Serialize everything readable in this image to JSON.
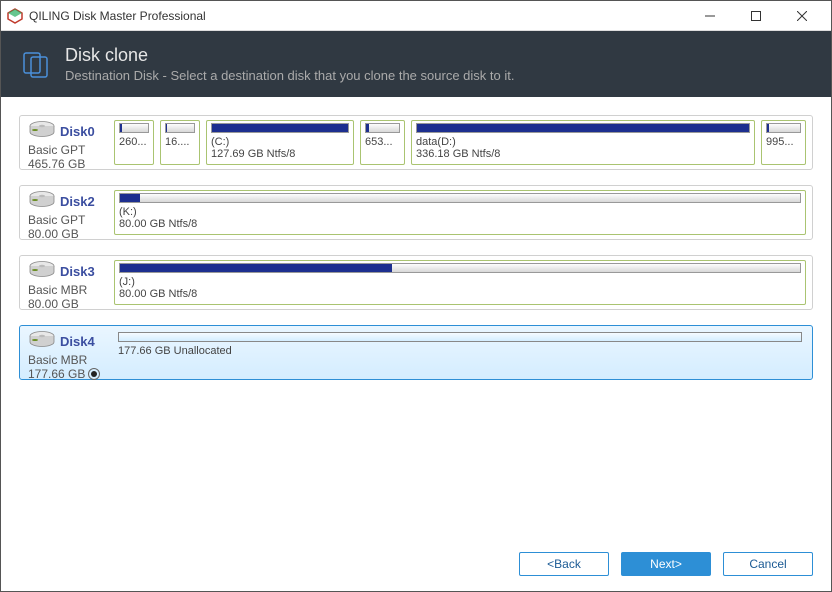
{
  "window": {
    "title": "QILING Disk Master Professional"
  },
  "header": {
    "title": "Disk clone",
    "subtitle": "Destination Disk - Select a destination disk that you clone the source disk to it."
  },
  "disks": [
    {
      "name": "Disk0",
      "type": "Basic GPT",
      "size": "465.76 GB",
      "selected": false,
      "partitions": [
        {
          "label": "",
          "sub": "260...",
          "fill": 6,
          "flex": "0 0 40px"
        },
        {
          "label": "",
          "sub": "16....",
          "fill": 3,
          "flex": "0 0 40px"
        },
        {
          "label": "(C:)",
          "sub": "127.69 GB Ntfs/8",
          "fill": 100,
          "flex": "0 0 148px"
        },
        {
          "label": "",
          "sub": "653...",
          "fill": 8,
          "flex": "0 0 45px"
        },
        {
          "label": "data(D:)",
          "sub": "336.18 GB Ntfs/8",
          "fill": 100,
          "flex": "1 1 290px"
        },
        {
          "label": "",
          "sub": "995...",
          "fill": 5,
          "flex": "0 0 45px"
        }
      ]
    },
    {
      "name": "Disk2",
      "type": "Basic GPT",
      "size": "80.00 GB",
      "selected": false,
      "partitions": [
        {
          "label": "(K:)",
          "sub": "80.00 GB Ntfs/8",
          "fill": 3,
          "flex": "1 1 auto"
        }
      ]
    },
    {
      "name": "Disk3",
      "type": "Basic MBR",
      "size": "80.00 GB",
      "selected": false,
      "partitions": [
        {
          "label": "(J:)",
          "sub": "80.00 GB Ntfs/8",
          "fill": 40,
          "flex": "1 1 auto"
        }
      ]
    },
    {
      "name": "Disk4",
      "type": "Basic MBR",
      "size": "177.66 GB",
      "selected": true,
      "partitions": [
        {
          "label": "",
          "sub": "177.66 GB Unallocated",
          "fill": 0,
          "flex": "1 1 auto",
          "unalloc": true
        }
      ]
    }
  ],
  "footer": {
    "back": "<Back",
    "next": "Next>",
    "cancel": "Cancel"
  }
}
